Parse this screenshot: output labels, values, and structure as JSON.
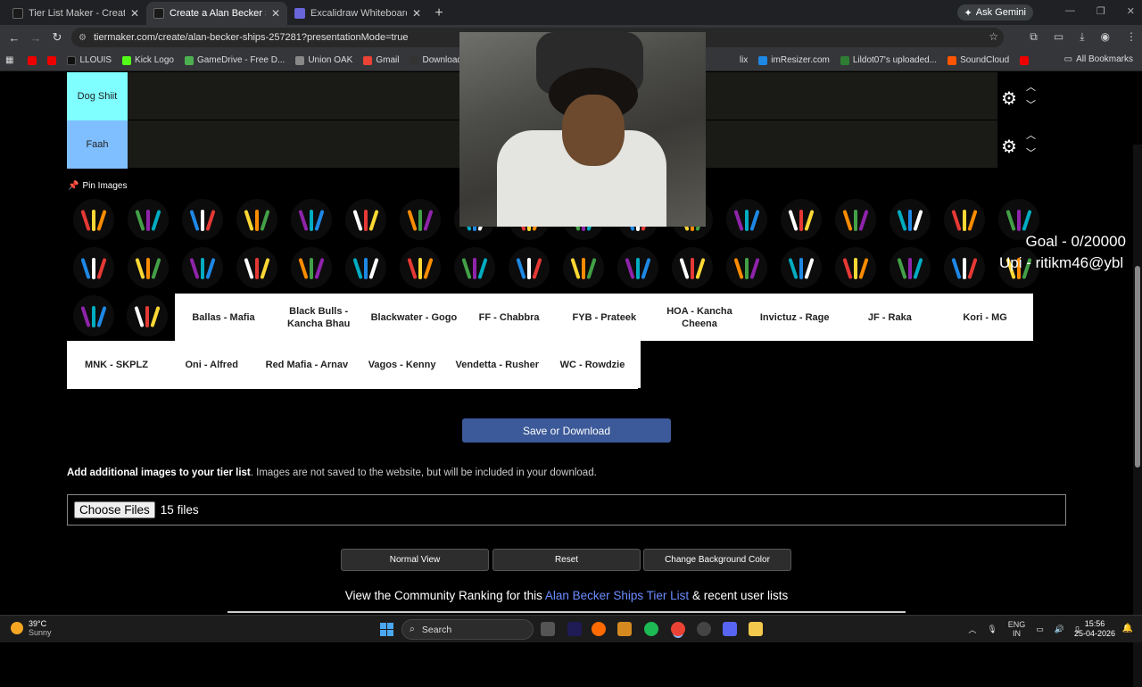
{
  "browser": {
    "tabs": [
      {
        "title": "Tier List Maker - Create a Tier L",
        "active": false
      },
      {
        "title": "Create a Alan Becker Ships Tier",
        "active": true
      },
      {
        "title": "Excalidraw Whiteboard",
        "active": false
      }
    ],
    "ask_gemini": "Ask Gemini",
    "url": "tiermaker.com/create/alan-becker-ships-257281?presentationMode=true",
    "bookmarks": [
      "LLOUIS",
      "Kick Logo",
      "GameDrive - Free D...",
      "Union OAK",
      "Gmail",
      "Download Pirate",
      "imResizer.com",
      "Lildot07's uploaded...",
      "SoundCloud"
    ],
    "bookmarks_partial": "lix",
    "all_bookmarks": "All Bookmarks"
  },
  "tiers": [
    {
      "label": "Dog Shiit",
      "color": "#7fffff"
    },
    {
      "label": "Faah",
      "color": "#7fbfff"
    }
  ],
  "pin_images_label": "Pin Images",
  "name_tiles_row1": [
    "Ballas - Mafia",
    "Black Bulls - Kancha Bhau",
    "Blackwater - Gogo",
    "FF - Chabbra",
    "FYB - Prateek",
    "HOA - Kancha Cheena",
    "Invictuz - Rage",
    "JF - Raka",
    "Kori - MG"
  ],
  "name_tiles_row2": [
    "MNK - SKPLZ",
    "Oni - Alfred",
    "Red Mafia - Arnav",
    "Vagos - Kenny",
    "Vendetta - Rusher",
    "WC - Rowdzie"
  ],
  "save_button": "Save or Download",
  "add_images": {
    "bold": "Add additional images to your tier list",
    "rest": ". Images are not saved to the website, but will be included in your download."
  },
  "file_input": {
    "button": "Choose Files",
    "status": "15 files"
  },
  "view_buttons": [
    "Normal View",
    "Reset",
    "Change Background Color"
  ],
  "community": {
    "prefix": "View the Community Ranking for this ",
    "link": "Alan Becker Ships Tier List",
    "suffix": " & recent user lists"
  },
  "stream_overlay": {
    "goal": "Goal - 0/20000",
    "upi": "Upi - ritikm46@ybl"
  },
  "taskbar": {
    "temperature": "39°C",
    "weather": "Sunny",
    "search": "Search",
    "lang": "ENG",
    "region": "IN",
    "time": "15:56",
    "date": "25-04-2026"
  }
}
